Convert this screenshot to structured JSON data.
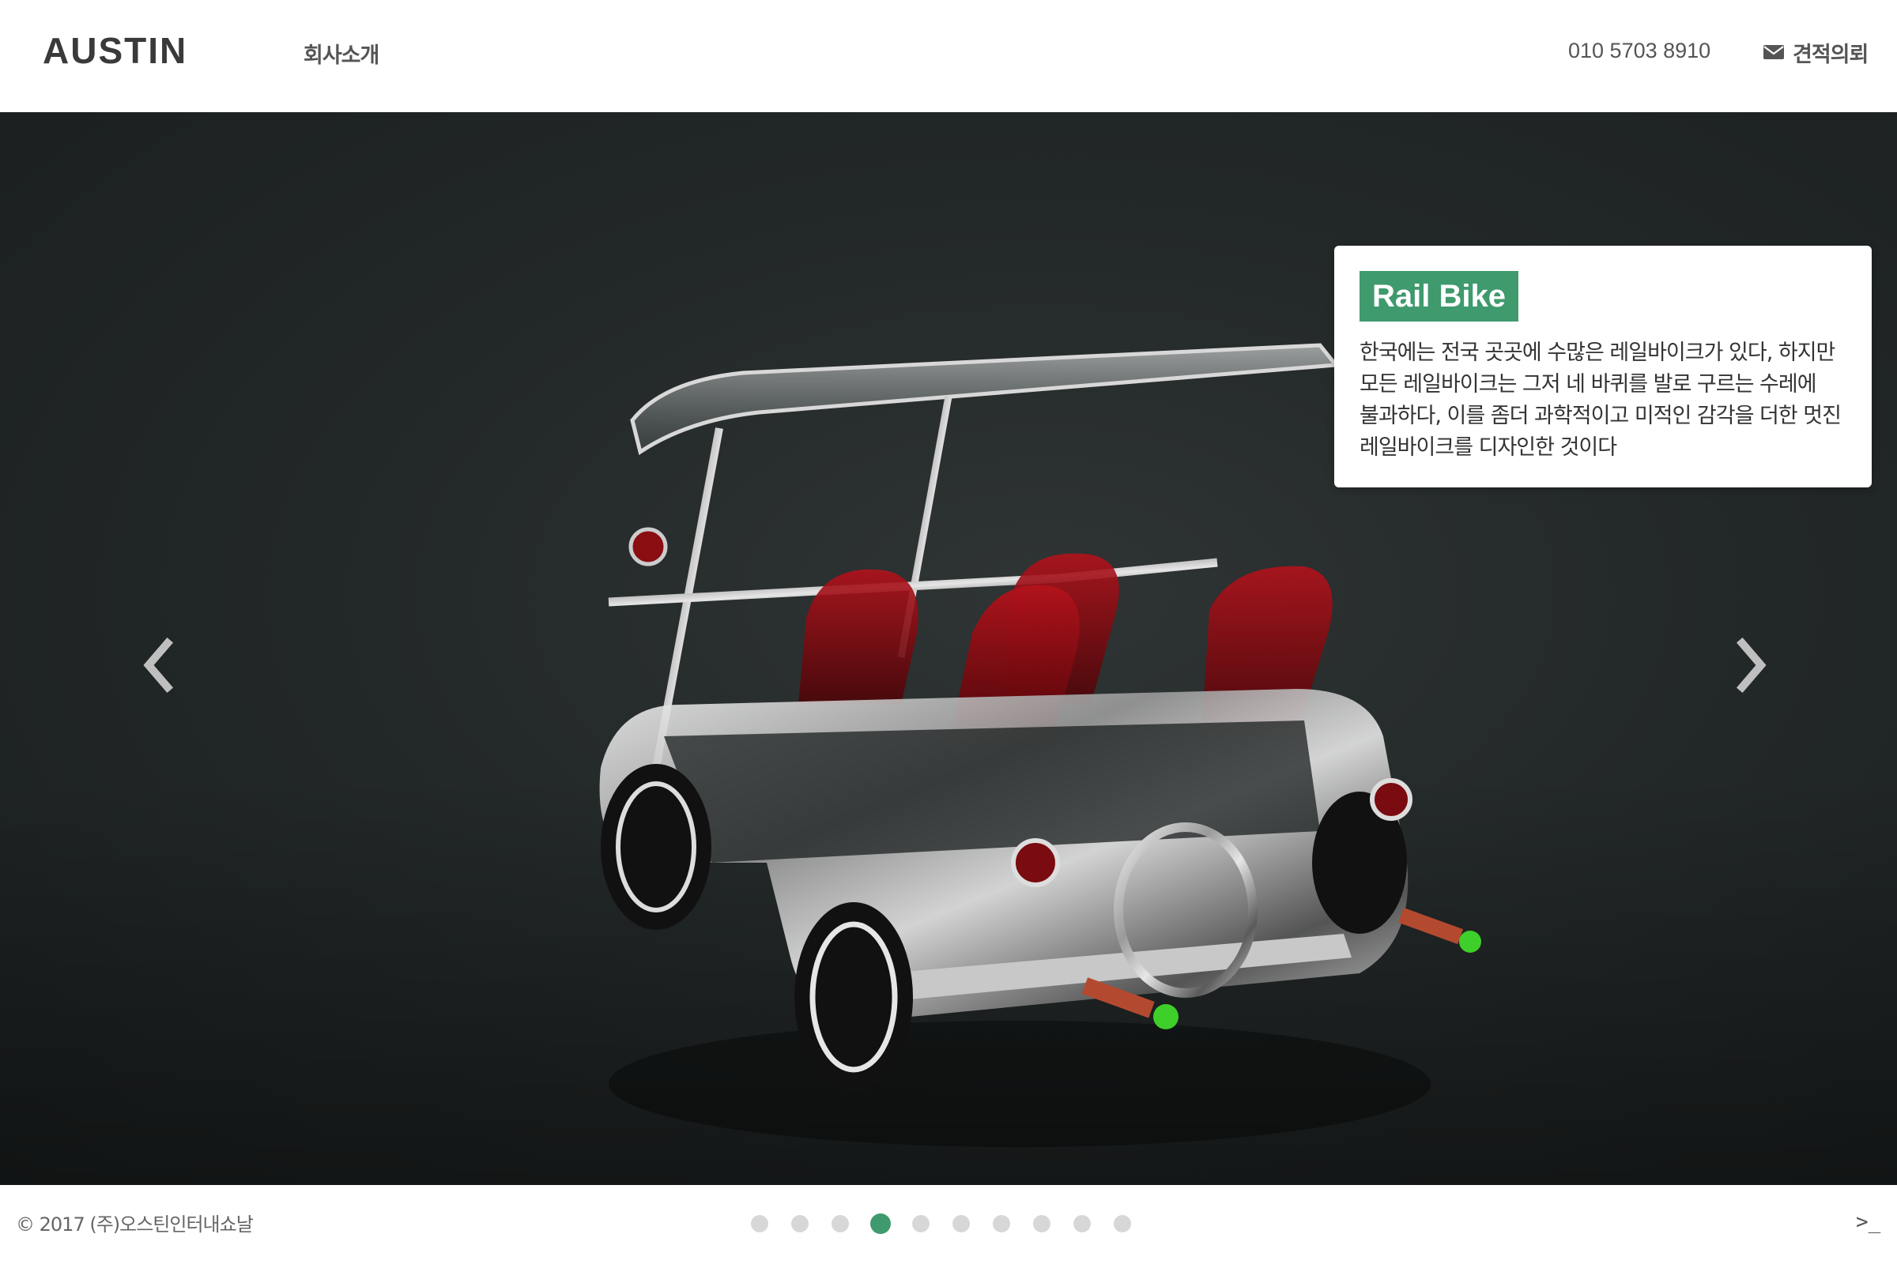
{
  "header": {
    "logo_text": "AUSTIN",
    "nav_about": "회사소개",
    "phone": "010 5703 8910",
    "quote_label": "견적의뢰",
    "quote_icon": "envelope-icon"
  },
  "hero": {
    "slide_image": "rail-bike-render",
    "prev_icon": "chevron-left-icon",
    "next_icon": "chevron-right-icon",
    "card": {
      "title": "Rail Bike",
      "description": "한국에는 전국 곳곳에 수많은 레일바이크가 있다, 하지만 모든 레일바이크는 그저 네 바퀴를 발로 구르는 수레에 불과하다, 이를 좀더 과학적이고 미적인 감각을 더한 멋진 레일바이크를 디자인한 것이다"
    }
  },
  "footer": {
    "copyright": "© 2017 (주)오스틴인터내쇼날",
    "slide_count": 10,
    "active_slide_index": 3,
    "prompt_icon_text": ">_"
  },
  "colors": {
    "accent": "#3f9a6e",
    "hero_background": "#232828",
    "dot_inactive": "#d7d7d7",
    "text": "#555555"
  }
}
